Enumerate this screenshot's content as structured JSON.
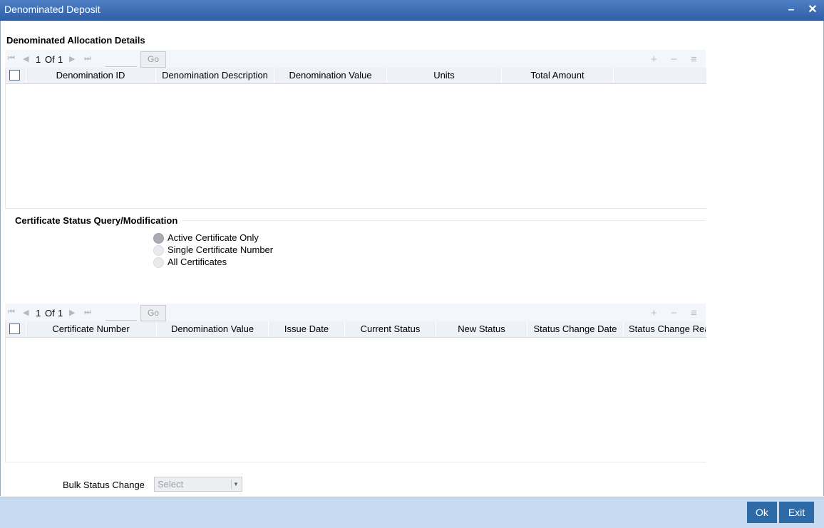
{
  "window": {
    "title": "Denominated Deposit"
  },
  "allocation": {
    "title": "Denominated Allocation Details",
    "pager": {
      "current": "1",
      "of": "Of",
      "total": "1",
      "go": "Go"
    },
    "columns": [
      "Denomination ID",
      "Denomination Description",
      "Denomination Value",
      "Units",
      "Total Amount"
    ]
  },
  "certificate_query": {
    "title": "Certificate Status Query/Modification",
    "options": [
      {
        "label": "Active Certificate Only",
        "selected": true
      },
      {
        "label": "Single Certificate Number",
        "selected": false
      },
      {
        "label": "All Certificates",
        "selected": false
      }
    ]
  },
  "certificates": {
    "pager": {
      "current": "1",
      "of": "Of",
      "total": "1",
      "go": "Go"
    },
    "columns": [
      "Certificate Number",
      "Denomination Value",
      "Issue Date",
      "Current Status",
      "New Status",
      "Status Change Date",
      "Status Change Rea"
    ]
  },
  "bulk": {
    "label": "Bulk Status Change",
    "select_value": "Select"
  },
  "footer": {
    "ok": "Ok",
    "exit": "Exit"
  },
  "colors": {
    "titlebar": "#3a6cb5",
    "footer": "#c6daf0",
    "button": "#2e6aa6"
  }
}
